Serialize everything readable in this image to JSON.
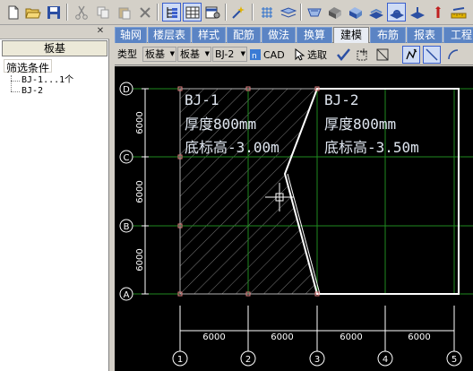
{
  "toolbar": {
    "icons": [
      "new-file-icon",
      "open-folder-icon",
      "save-icon",
      "cut-icon",
      "copy-icon",
      "paste-icon",
      "delete-icon",
      "tree-view-icon",
      "table-view-icon",
      "properties-icon",
      "check-icon",
      "grid-icon",
      "layers-icon",
      "view-3d-front-icon",
      "view-3d-left-icon",
      "view-3d-right-icon",
      "view-3d-iso-icon",
      "view-plan-icon",
      "view-floor-icon",
      "rotate-icon",
      "ruler-icon"
    ]
  },
  "left_panel": {
    "title": "板基",
    "filter_label": "筛选条件",
    "tree": [
      "BJ-1...1个",
      "BJ-2"
    ]
  },
  "tabs": [
    {
      "label": "轴网"
    },
    {
      "label": "楼层表"
    },
    {
      "label": "样式"
    },
    {
      "label": "配筋"
    },
    {
      "label": "做法"
    },
    {
      "label": "换算"
    },
    {
      "label": "建模"
    },
    {
      "label": "布筋"
    },
    {
      "label": "报表"
    },
    {
      "label": "工程"
    }
  ],
  "toolbar2": {
    "type_label": "类型",
    "type_value1": "板基",
    "type_value2": "板基",
    "type_value3": "BJ-2",
    "cad_label": "CAD",
    "select_label": "选取"
  },
  "drawing": {
    "axis_rows": [
      "D",
      "C",
      "B",
      "A"
    ],
    "axis_cols": [
      "1",
      "2",
      "3",
      "4",
      "5"
    ],
    "row_dims": [
      "6000",
      "6000",
      "6000"
    ],
    "col_dims": [
      "6000",
      "6000",
      "6000",
      "6000"
    ],
    "slab1": {
      "name": "BJ-1",
      "thickness": "厚度800mm",
      "elevation": "底标高-3.00m"
    },
    "slab2": {
      "name": "BJ-2",
      "thickness": "厚度800mm",
      "elevation": "底标高-3.50m"
    }
  },
  "colors": {
    "grid": "#1f8a1f",
    "slab_outline": "#ffffff",
    "hatch": "#7a7a7a",
    "tab_bg": "#5b84c4"
  }
}
